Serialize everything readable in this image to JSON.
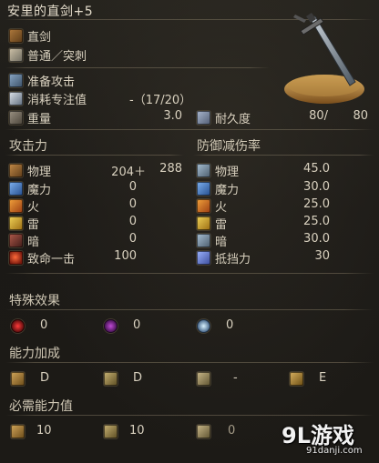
{
  "item": {
    "name": "安里的直剑+5",
    "weapon_type": "直剑",
    "attack_type": "普通／突刺",
    "skill": "准备攻击",
    "fp_cost_label": "消耗专注值",
    "fp_cost_value": "-（17/20）",
    "weight_label": "重量",
    "weight_value": "3.0",
    "durability_label": "耐久度",
    "durability_current": "80/",
    "durability_max": "80"
  },
  "attack": {
    "header": "攻击力",
    "rows": [
      {
        "icon": "physical-attack-icon",
        "label": "物理",
        "value": "204＋",
        "bonus": "288"
      },
      {
        "icon": "magic-attack-icon",
        "label": "魔力",
        "value": "0",
        "bonus": ""
      },
      {
        "icon": "fire-attack-icon",
        "label": "火",
        "value": "0",
        "bonus": ""
      },
      {
        "icon": "lightning-attack-icon",
        "label": "雷",
        "value": "0",
        "bonus": ""
      },
      {
        "icon": "dark-attack-icon",
        "label": "暗",
        "value": "0",
        "bonus": ""
      },
      {
        "icon": "critical-icon",
        "label": "致命一击",
        "value": "100",
        "bonus": ""
      }
    ]
  },
  "defense": {
    "header": "防御减伤率",
    "rows": [
      {
        "icon": "physical-defense-icon",
        "label": "物理",
        "value": "45.0"
      },
      {
        "icon": "magic-defense-icon",
        "label": "魔力",
        "value": "30.0"
      },
      {
        "icon": "fire-defense-icon",
        "label": "火",
        "value": "25.0"
      },
      {
        "icon": "lightning-defense-icon",
        "label": "雷",
        "value": "25.0"
      },
      {
        "icon": "dark-defense-icon",
        "label": "暗",
        "value": "30.0"
      },
      {
        "icon": "stability-icon",
        "label": "抵挡力",
        "value": "30"
      }
    ]
  },
  "effects": {
    "header": "特殊效果",
    "items": [
      {
        "icon": "bleed-icon",
        "value": "0"
      },
      {
        "icon": "poison-icon",
        "value": "0"
      },
      {
        "icon": "frost-icon",
        "value": "0"
      }
    ]
  },
  "scaling": {
    "header": "能力加成",
    "items": [
      {
        "icon": "strength-icon",
        "value": "D"
      },
      {
        "icon": "dexterity-icon",
        "value": "D"
      },
      {
        "icon": "intelligence-icon",
        "value": "-"
      },
      {
        "icon": "faith-icon",
        "value": "E"
      }
    ]
  },
  "requirements": {
    "header": "必需能力值",
    "items": [
      {
        "icon": "strength-icon",
        "value": "10"
      },
      {
        "icon": "dexterity-icon",
        "value": "10"
      },
      {
        "icon": "intelligence-icon",
        "value": "0"
      }
    ]
  },
  "watermark": {
    "logo": "9L游戏",
    "url": "91danji.com"
  }
}
